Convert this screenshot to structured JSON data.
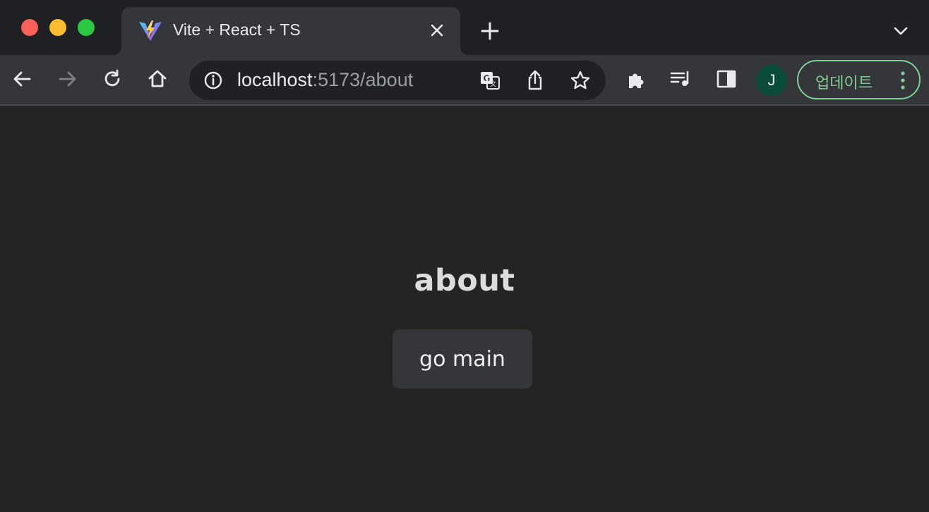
{
  "window": {
    "controls": [
      "close",
      "minimize",
      "maximize"
    ]
  },
  "tab": {
    "title": "Vite + React + TS",
    "favicon": "vite-logo-icon"
  },
  "toolbar": {
    "url_host": "localhost",
    "url_path": ":5173/about",
    "profile_initial": "J",
    "update_label": "업데이트"
  },
  "page": {
    "heading": "about",
    "button_label": "go main"
  },
  "colors": {
    "page_bg": "#242424",
    "toolbar_bg": "#35363a",
    "accent_green": "#81c995",
    "avatar_bg": "#0b4b3a"
  }
}
